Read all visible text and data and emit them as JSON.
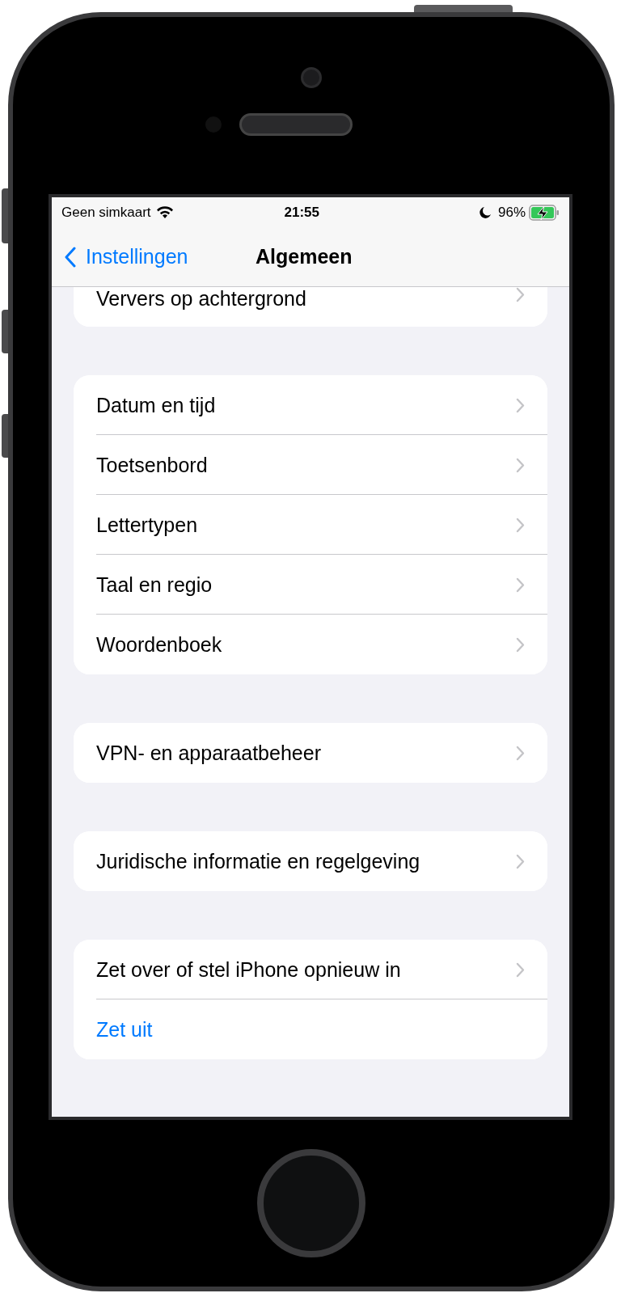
{
  "status_bar": {
    "carrier": "Geen simkaart",
    "time": "21:55",
    "battery": "96%",
    "charging": true
  },
  "nav": {
    "back": "Instellingen",
    "title": "Algemeen"
  },
  "groups": [
    {
      "clipped": true,
      "items": [
        {
          "label": "Ververs op achtergrond",
          "kind": "link"
        }
      ]
    },
    {
      "clipped": false,
      "items": [
        {
          "label": "Datum en tijd",
          "kind": "link"
        },
        {
          "label": "Toetsenbord",
          "kind": "link"
        },
        {
          "label": "Lettertypen",
          "kind": "link"
        },
        {
          "label": "Taal en regio",
          "kind": "link"
        },
        {
          "label": "Woordenboek",
          "kind": "link"
        }
      ]
    },
    {
      "clipped": false,
      "items": [
        {
          "label": "VPN- en apparaatbeheer",
          "kind": "link"
        }
      ]
    },
    {
      "clipped": false,
      "items": [
        {
          "label": "Juridische informatie en regelgeving",
          "kind": "link"
        }
      ]
    },
    {
      "clipped": false,
      "items": [
        {
          "label": "Zet over of stel iPhone opnieuw in",
          "kind": "link"
        },
        {
          "label": "Zet uit",
          "kind": "action"
        }
      ]
    }
  ]
}
